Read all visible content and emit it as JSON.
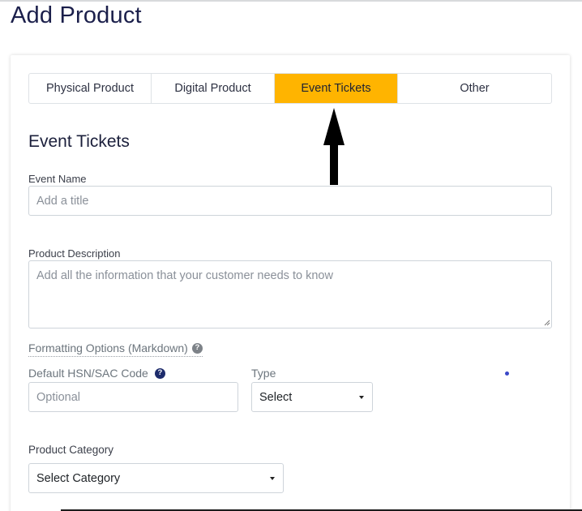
{
  "page": {
    "title": "Add Product"
  },
  "tabs": [
    {
      "label": "Physical Product",
      "active": false
    },
    {
      "label": "Digital Product",
      "active": false
    },
    {
      "label": "Event Tickets",
      "active": true
    },
    {
      "label": "Other",
      "active": false
    }
  ],
  "colors": {
    "active_tab": "#ffb400",
    "title": "#1b1f4b"
  },
  "section": {
    "title": "Event Tickets"
  },
  "event_name": {
    "label": "Event Name",
    "placeholder": "Add a title",
    "value": ""
  },
  "description": {
    "label": "Product Description",
    "placeholder": "Add all the information that your customer needs to know",
    "value": ""
  },
  "formatting": {
    "label": "Formatting Options (Markdown)",
    "icon": "question-circle-icon"
  },
  "hsn": {
    "label": "Default HSN/SAC Code",
    "placeholder": "Optional",
    "value": "",
    "icon": "question-circle-icon"
  },
  "type": {
    "label": "Type",
    "selected": "Select"
  },
  "category": {
    "label": "Product Category",
    "selected": "Select Category"
  }
}
